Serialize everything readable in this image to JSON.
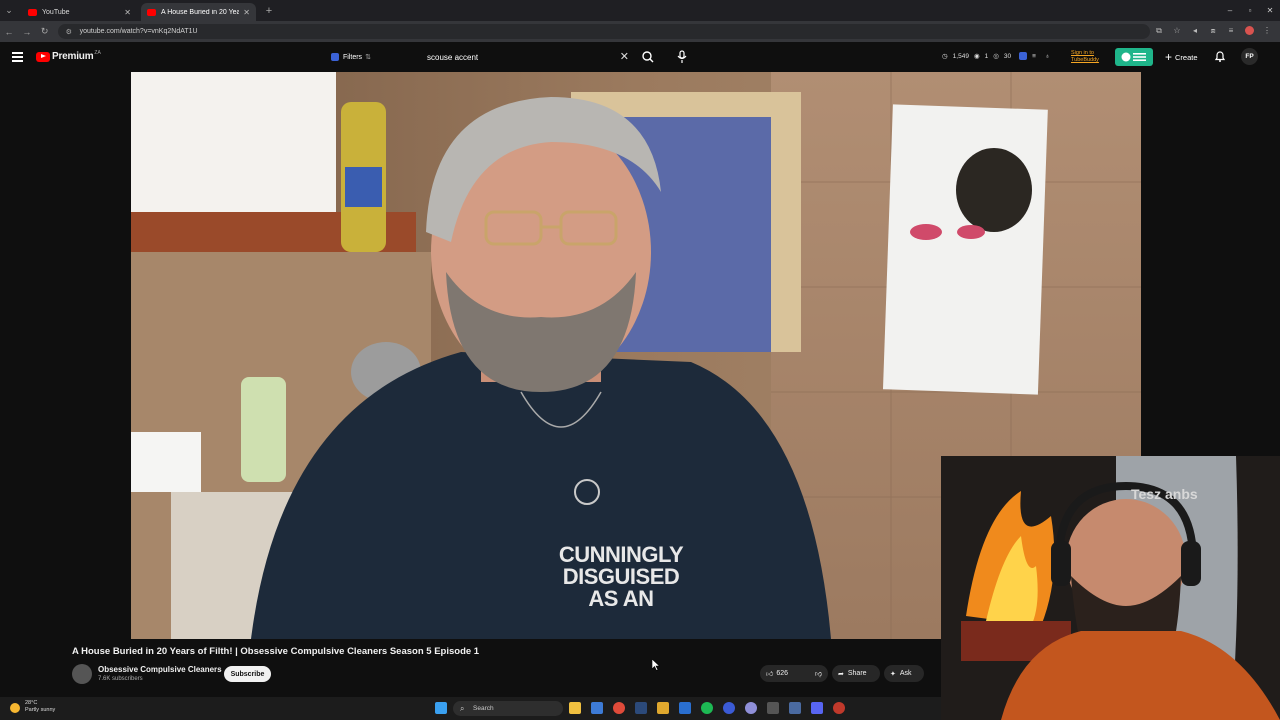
{
  "browser": {
    "tabs": [
      {
        "label": "YouTube",
        "active": false
      },
      {
        "label": "A House Buried in 20 Year...",
        "active": true
      }
    ],
    "url": "youtube.com/watch?v=vnKq2NdAT1U"
  },
  "youtube": {
    "logo_text": "Premium",
    "logo_country": "ZA",
    "filters_label": "Filters",
    "search_value": "scouse accent",
    "stats": {
      "views": "1,549",
      "first": "1",
      "second": "30"
    },
    "tubebuddy_text": "Sign in to TubeBuddy",
    "create_label": "Create",
    "avatar_initials": "FP"
  },
  "video": {
    "title": "A House Buried in 20 Years of Filth! | Obsessive Compulsive Cleaners Season 5 Episode 1",
    "shirt_text": "CUNNINGLY DISGUISED AS AN",
    "channel": "Obsessive Compulsive Cleaners",
    "subscribers": "7.6K subscribers",
    "subscribe_label": "Subscribe",
    "likes": "626",
    "share_label": "Share",
    "ask_label": "Ask"
  },
  "webcam": {
    "chair_text": "Tesz anbs"
  },
  "taskbar": {
    "temperature": "28°C",
    "weather": "Partly sunny",
    "search_label": "Search"
  },
  "colors": {
    "yt_red": "#ff0000",
    "background": "#0f0f0f",
    "tubebuddy_green": "#1fb58a",
    "tubebuddy_orange": "#f6a623"
  }
}
